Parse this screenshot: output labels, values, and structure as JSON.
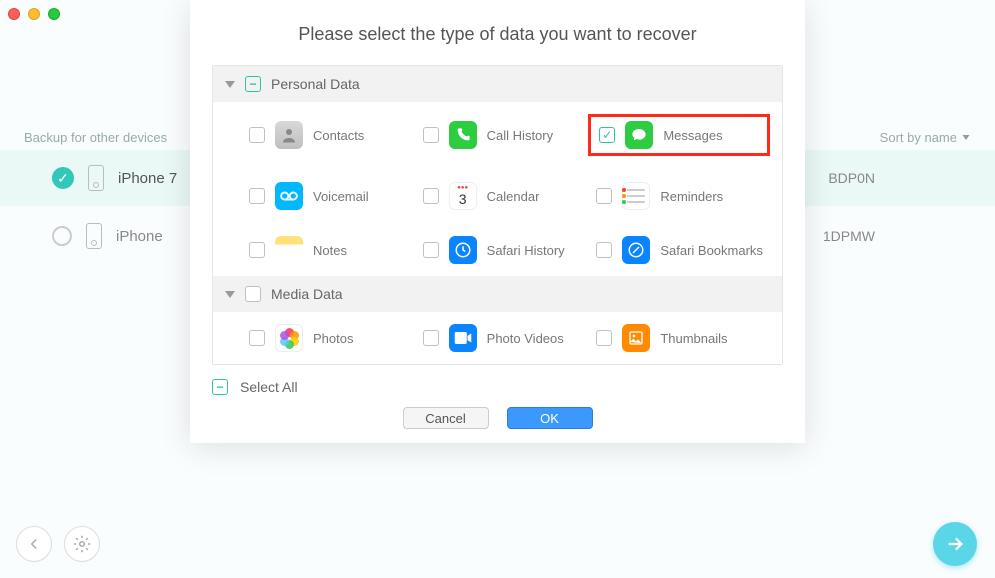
{
  "window": {
    "backup_label": "Backup for other devices",
    "sort_label": "Sort by name"
  },
  "devices": [
    {
      "name": "iPhone 7",
      "serial": "BDP0N",
      "selected": true
    },
    {
      "name": "iPhone",
      "serial": "1DPMW",
      "selected": false
    }
  ],
  "modal": {
    "title": "Please select the type of data you want to recover",
    "select_all": "Select All",
    "cancel": "Cancel",
    "ok": "OK",
    "sections": {
      "personal": {
        "title": "Personal Data",
        "items": {
          "contacts": "Contacts",
          "call_history": "Call History",
          "messages": "Messages",
          "voicemail": "Voicemail",
          "calendar": "Calendar",
          "reminders": "Reminders",
          "notes": "Notes",
          "safari_history": "Safari History",
          "safari_bookmarks": "Safari Bookmarks"
        }
      },
      "media": {
        "title": "Media Data",
        "items": {
          "photos": "Photos",
          "photo_videos": "Photo Videos",
          "thumbnails": "Thumbnails"
        }
      }
    },
    "calendar_day": "3"
  }
}
